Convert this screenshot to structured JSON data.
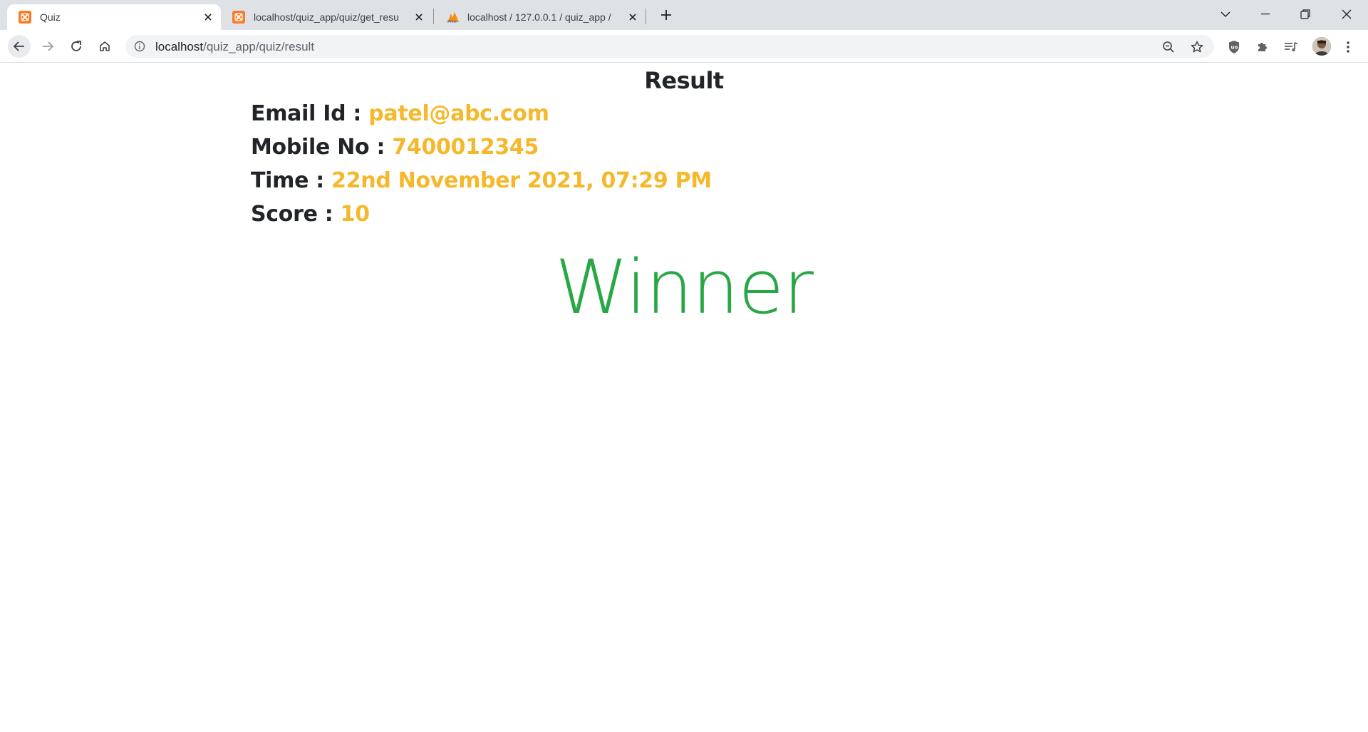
{
  "browser": {
    "tabs": [
      {
        "title": "Quiz",
        "active": true,
        "favicon": "xampp-icon"
      },
      {
        "title": "localhost/quiz_app/quiz/get_resu",
        "active": false,
        "favicon": "xampp-icon"
      },
      {
        "title": "localhost / 127.0.0.1 / quiz_app /",
        "active": false,
        "favicon": "phpmyadmin-icon"
      }
    ],
    "url_host": "localhost",
    "url_path": "/quiz_app/quiz/result"
  },
  "page": {
    "title": "Result",
    "fields": [
      {
        "label": "Email Id : ",
        "value": "patel@abc.com"
      },
      {
        "label": "Mobile No : ",
        "value": "7400012345"
      },
      {
        "label": "Time : ",
        "value": "22nd November 2021, 07:29 PM"
      },
      {
        "label": "Score : ",
        "value": "10"
      }
    ],
    "verdict": "Winner"
  },
  "colors": {
    "value": "#f6b82b",
    "verdict": "#28a745",
    "text": "#212529"
  }
}
